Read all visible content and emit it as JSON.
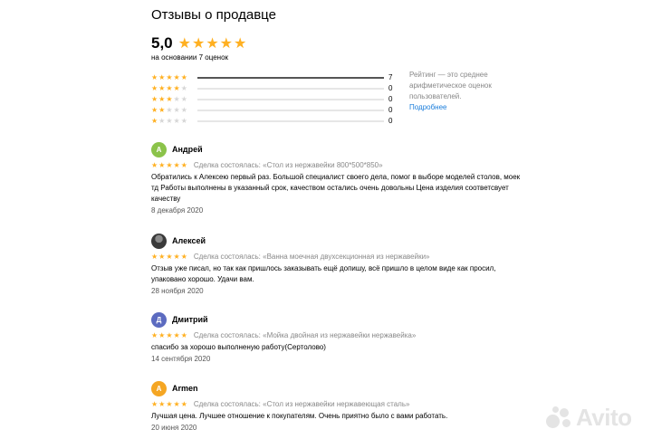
{
  "title": "Отзывы о продавце",
  "rating": {
    "average": "5,0",
    "stars": "★★★★★",
    "basis": "на основании 7 оценок",
    "distribution": [
      {
        "stars": 5,
        "count": "7",
        "fraction": 1.0
      },
      {
        "stars": 4,
        "count": "0",
        "fraction": 0
      },
      {
        "stars": 3,
        "count": "0",
        "fraction": 0
      },
      {
        "stars": 2,
        "count": "0",
        "fraction": 0
      },
      {
        "stars": 1,
        "count": "0",
        "fraction": 0
      }
    ],
    "note": "Рейтинг — это среднее арифметическое оценок пользователей.",
    "more_link": "Подробнее"
  },
  "reviews": [
    {
      "avatar_letter": "А",
      "avatar_color": "#8bc34a",
      "name": "Андрей",
      "stars": "★★★★★",
      "deal": "Сделка состоялась: «Стол из нержавейки 800*500*850»",
      "text": "Обратились к Алексею первый раз. Большой специалист своего дела, помог в выборе моделей столов, моек тд Работы выполнены в указанный срок, качеством остались очень довольны Цена изделия соответсвует качеству",
      "date": "8 декабря 2020"
    },
    {
      "avatar_letter": "",
      "avatar_color": "#4a4a4a",
      "name": "Алексей",
      "stars": "★★★★★",
      "deal": "Сделка состоялась: «Ванна моечная двухсекционная из нержавейки»",
      "text": "Отзыв уже писал, но так как пришлось заказывать ещё допишу, всё пришло в целом виде как просил, упаковано хорошо. Удачи вам.",
      "date": "28 ноября 2020"
    },
    {
      "avatar_letter": "Д",
      "avatar_color": "#5c6bc0",
      "name": "Дмитрий",
      "stars": "★★★★★",
      "deal": "Сделка состоялась: «Мойка двойная из нержавейки нержавейка»",
      "text": "спасибо за хорошо выполненую работу(Сертолово)",
      "date": "14 сентября 2020"
    },
    {
      "avatar_letter": "A",
      "avatar_color": "#f5a623",
      "name": "Armen",
      "stars": "★★★★★",
      "deal": "Сделка состоялась: «Стол из нержавейки нержавеющая сталь»",
      "text": "Лучшая цена. Лучшее отношение к покупателям. Очень приятно было с вами работать.",
      "date": "20 июня 2020"
    }
  ],
  "watermark": "Avito",
  "colors": {
    "star": "#ffb021",
    "link": "#1a7ddb",
    "muted": "#888888"
  }
}
